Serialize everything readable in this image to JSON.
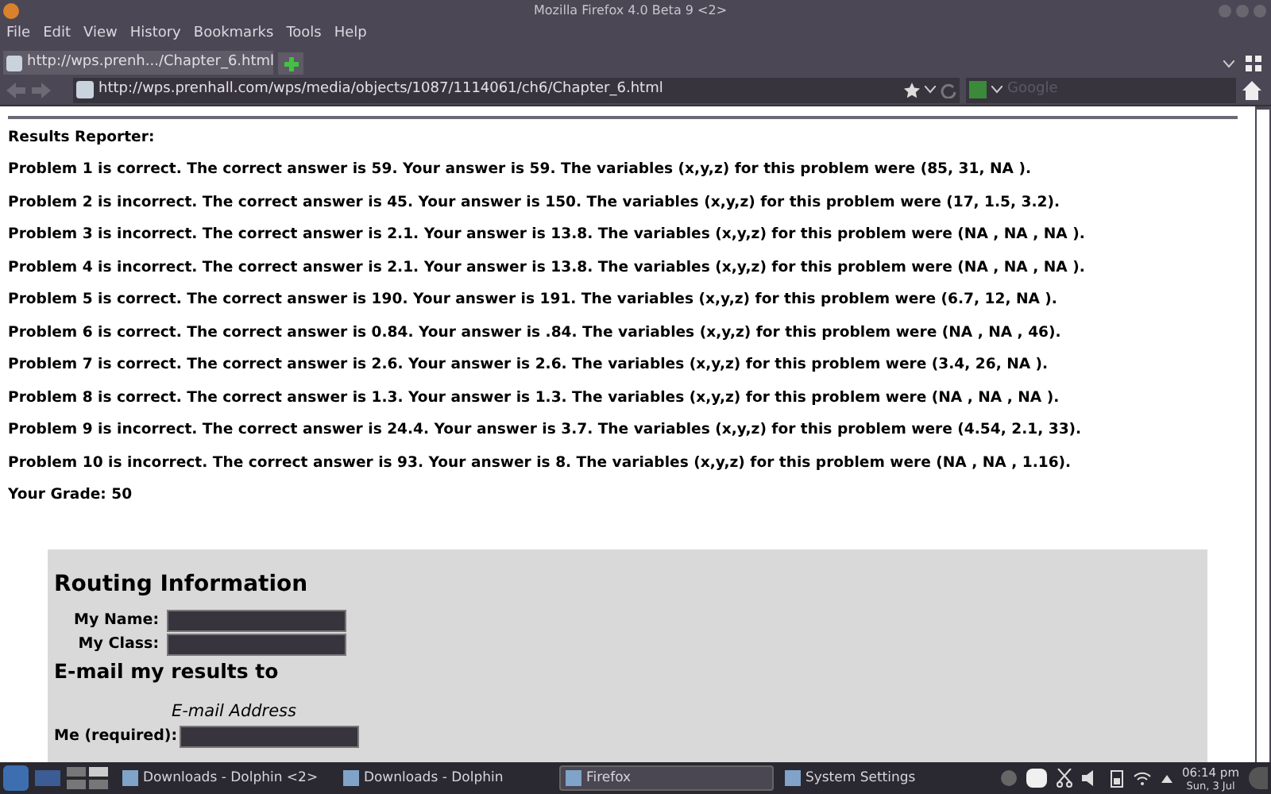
{
  "window": {
    "title": "Mozilla Firefox 4.0 Beta 9 <2>"
  },
  "menu": [
    "File",
    "Edit",
    "View",
    "History",
    "Bookmarks",
    "Tools",
    "Help"
  ],
  "tabs": [
    {
      "label": "http://wps.prenh.../Chapter_6.html",
      "selected": true
    }
  ],
  "address_bar": {
    "value": "http://wps.prenhall.com/wps/media/objects/1087/1114061/ch6/Chapter_6.html"
  },
  "search": {
    "placeholder": "Google"
  },
  "results": {
    "heading": "Results Reporter:",
    "lines": [
      "Problem 1 is correct. The correct answer is 59. Your answer is 59. The variables (x,y,z) for this problem were (85, 31, NA ).",
      "Problem 2 is incorrect. The correct answer is 45. Your answer is 150. The variables (x,y,z) for this problem were (17, 1.5, 3.2).",
      "Problem 3 is incorrect. The correct answer is 2.1. Your answer is 13.8. The variables (x,y,z) for this problem were (NA , NA , NA ).",
      "Problem 4 is incorrect. The correct answer is 2.1. Your answer is 13.8. The variables (x,y,z) for this problem were (NA , NA , NA ).",
      "Problem 5 is correct. The correct answer is 190. Your answer is 191. The variables (x,y,z) for this problem were (6.7, 12, NA ).",
      "Problem 6 is correct. The correct answer is 0.84. Your answer is .84. The variables (x,y,z) for this problem were (NA , NA , 46).",
      "Problem 7 is correct. The correct answer is 2.6. Your answer is 2.6. The variables (x,y,z) for this problem were (3.4, 26, NA ).",
      "Problem 8 is correct. The correct answer is 1.3. Your answer is 1.3. The variables (x,y,z) for this problem were (NA , NA , NA ).",
      "Problem 9 is incorrect. The correct answer is 24.4. Your answer is 3.7. The variables (x,y,z) for this problem were (4.54, 2.1, 33).",
      "Problem 10 is incorrect. The correct answer is 93. Your answer is 8. The variables (x,y,z) for this problem were (NA , NA , 1.16)."
    ],
    "grade": "Your Grade: 50"
  },
  "routing": {
    "title": "Routing Information",
    "fields": [
      {
        "label": "My Name:"
      },
      {
        "label": "My Class:"
      }
    ],
    "email_heading": "E-mail my results to",
    "email_column": "E-mail Address",
    "email_fields": [
      {
        "label": "Me (required):"
      }
    ]
  },
  "taskbar": {
    "tasks": [
      {
        "label": "Downloads - Dolphin <2>",
        "selected": false
      },
      {
        "label": "Downloads - Dolphin",
        "selected": false
      },
      {
        "label": "Firefox",
        "selected": true
      },
      {
        "label": "System Settings",
        "selected": false
      }
    ],
    "time": "06:14 pm",
    "date": "Sun, 3 Jul"
  }
}
